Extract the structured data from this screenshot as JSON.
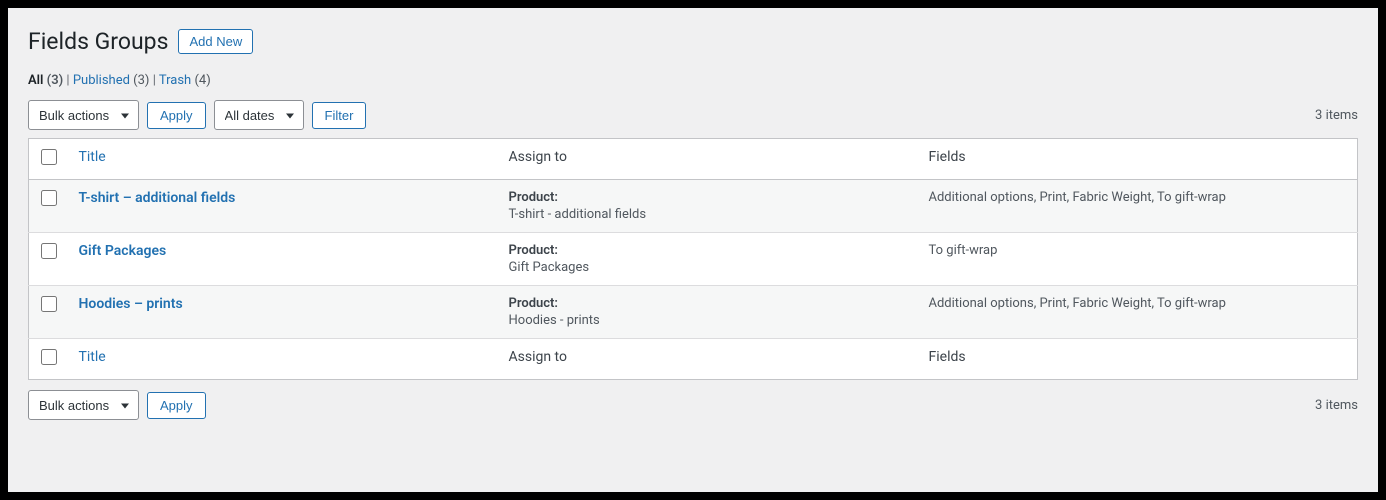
{
  "page": {
    "title": "Fields Groups",
    "add_new_label": "Add New"
  },
  "filters": {
    "all_label": "All",
    "all_count": "(3)",
    "published_label": "Published",
    "published_count": "(3)",
    "trash_label": "Trash",
    "trash_count": "(4)",
    "separator": " | "
  },
  "tablenav": {
    "bulk_actions_label": "Bulk actions",
    "apply_label": "Apply",
    "all_dates_label": "All dates",
    "filter_label": "Filter",
    "items_count": "3 items"
  },
  "table": {
    "columns": {
      "title": "Title",
      "assign_to": "Assign to",
      "fields": "Fields"
    },
    "rows": [
      {
        "title": "T-shirt – additional fields",
        "assign_key": "Product:",
        "assign_value": "T-shirt - additional fields",
        "fields": "Additional options, Print, Fabric Weight, To gift-wrap"
      },
      {
        "title": "Gift Packages",
        "assign_key": "Product:",
        "assign_value": "Gift Packages",
        "fields": "To gift-wrap"
      },
      {
        "title": "Hoodies – prints",
        "assign_key": "Product:",
        "assign_value": "Hoodies - prints",
        "fields": "Additional options, Print, Fabric Weight, To gift-wrap"
      }
    ]
  }
}
